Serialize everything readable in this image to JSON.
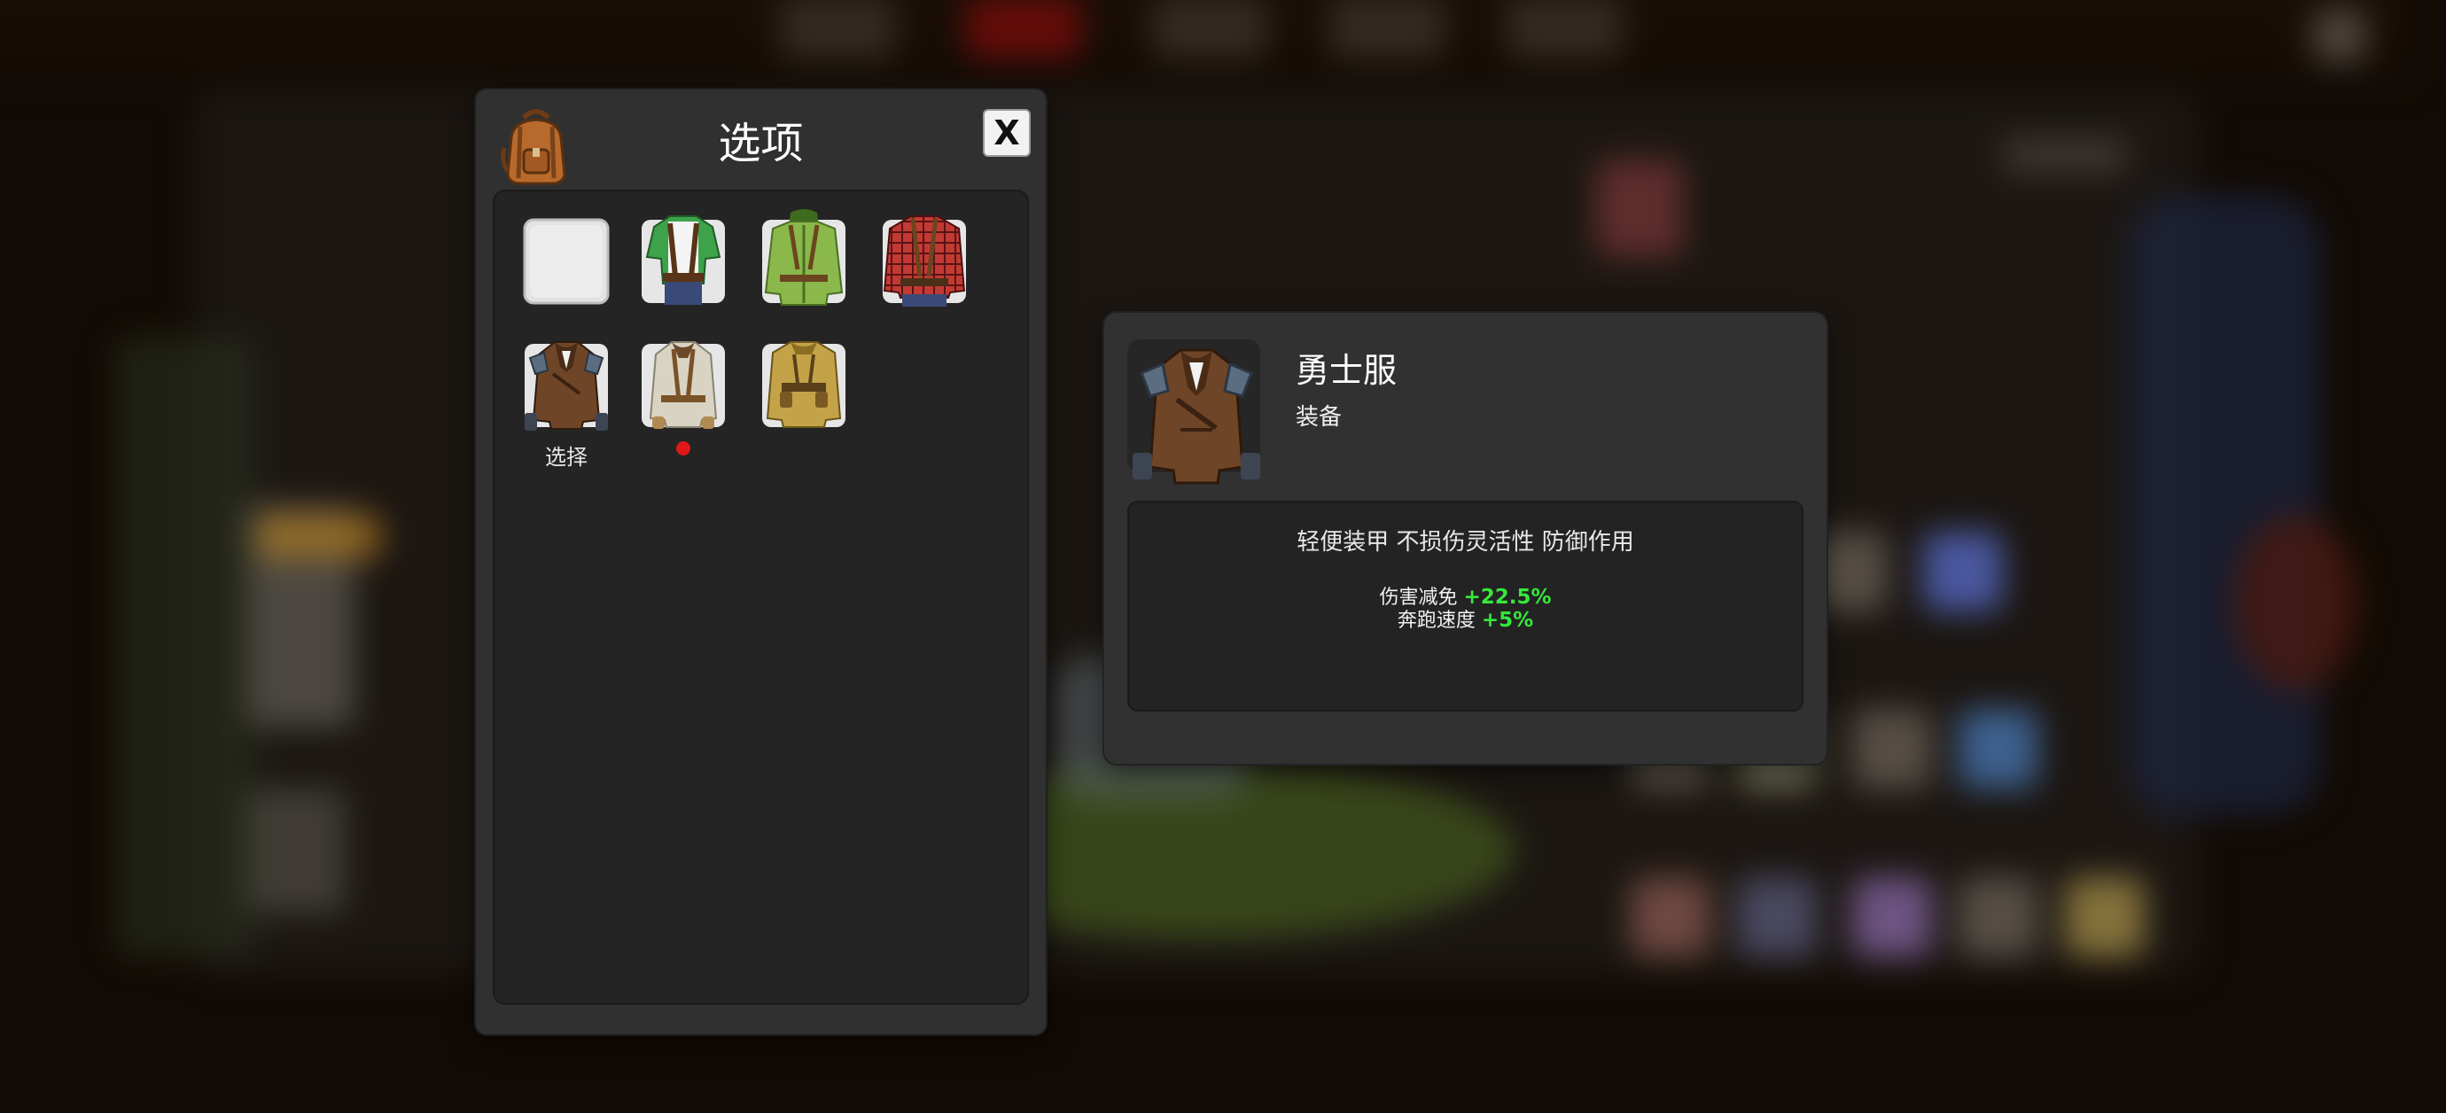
{
  "panel": {
    "title": "选项",
    "close_label": "X",
    "items": [
      {
        "name": "empty-slot",
        "caption": ""
      },
      {
        "name": "green-tshirt-outfit",
        "caption": ""
      },
      {
        "name": "green-hooded-jacket",
        "caption": ""
      },
      {
        "name": "red-plaid-shirt",
        "caption": ""
      },
      {
        "name": "warrior-armor-jacket",
        "caption": "选择"
      },
      {
        "name": "white-explorer-jacket",
        "caption": ""
      },
      {
        "name": "khaki-field-jacket",
        "caption": ""
      }
    ]
  },
  "detail": {
    "name": "勇士服",
    "type": "装备",
    "description": "轻便装甲 不损伤灵活性 防御作用",
    "stats": [
      {
        "label": "伤害减免",
        "value": "+22.5%"
      },
      {
        "label": "奔跑速度",
        "value": "+5%"
      }
    ]
  },
  "colors": {
    "stat_positive": "#35e83a",
    "notify_dot": "#e01818",
    "panel_bg": "#303030"
  }
}
